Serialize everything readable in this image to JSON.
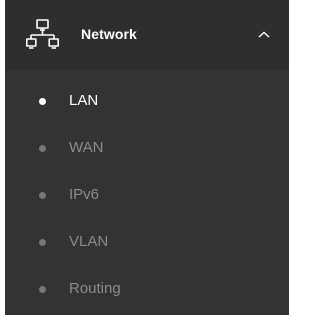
{
  "network_menu": {
    "title": "Network",
    "icon": "network-topology-icon",
    "expanded_icon": "chevron-up-icon",
    "colors": {
      "panel_bg": "#333333",
      "header_bg": "#2e2e2e",
      "active_text": "#ffffff",
      "inactive_text": "#8c8c8c"
    },
    "items": [
      {
        "label": "LAN",
        "active": true
      },
      {
        "label": "WAN",
        "active": false
      },
      {
        "label": "IPv6",
        "active": false
      },
      {
        "label": "VLAN",
        "active": false
      },
      {
        "label": "Routing",
        "active": false
      }
    ]
  }
}
